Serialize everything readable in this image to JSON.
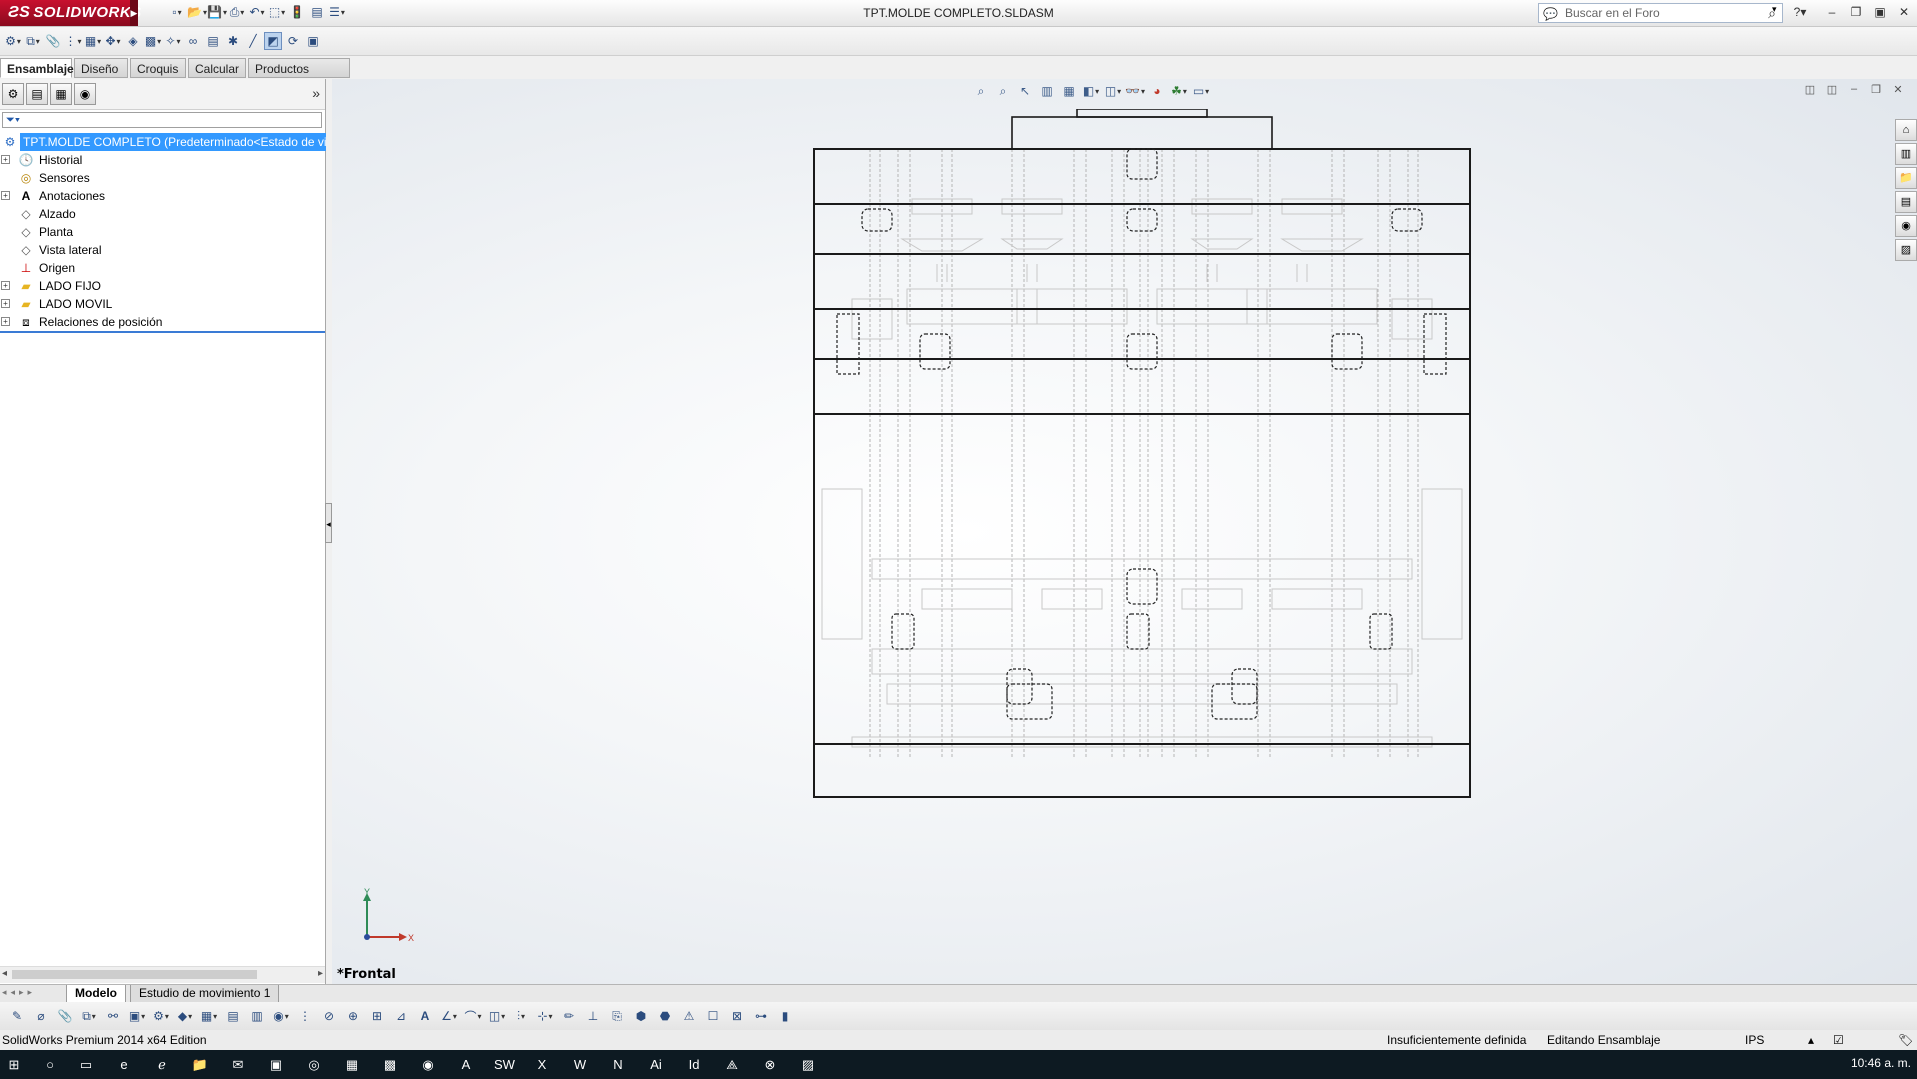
{
  "app": {
    "logo": "SOLIDWORKS",
    "window_title": "TPT.MOLDE COMPLETO.SLDASM",
    "search_placeholder": "Buscar en el Foro"
  },
  "tabs": [
    "Ensamblaje",
    "Diseño",
    "Croquis",
    "Calcular",
    "Productos Office"
  ],
  "tree": {
    "root": "TPT.MOLDE COMPLETO  (Predeterminado<Estado de visu",
    "items": [
      {
        "label": "Historial",
        "icon": "history-icon",
        "expand": true
      },
      {
        "label": "Sensores",
        "icon": "sensor-icon",
        "expand": false
      },
      {
        "label": "Anotaciones",
        "icon": "annotation-icon",
        "expand": true
      },
      {
        "label": "Alzado",
        "icon": "plane-icon",
        "expand": false
      },
      {
        "label": "Planta",
        "icon": "plane-icon",
        "expand": false
      },
      {
        "label": "Vista lateral",
        "icon": "plane-icon",
        "expand": false
      },
      {
        "label": "Origen",
        "icon": "origin-icon",
        "expand": false
      },
      {
        "label": "LADO FIJO",
        "icon": "folder-icon",
        "expand": true
      },
      {
        "label": "LADO MOVIL",
        "icon": "folder-icon",
        "expand": true
      },
      {
        "label": "Relaciones de posición",
        "icon": "mates-icon",
        "expand": true
      }
    ]
  },
  "viewport": {
    "view_label": "*Frontal",
    "triad_x": "X",
    "triad_y": "Y"
  },
  "bottom_tabs": [
    "Modelo",
    "Estudio de movimiento 1"
  ],
  "status": {
    "edition": "SolidWorks Premium 2014 x64 Edition",
    "definition": "Insuficientemente definida",
    "mode": "Editando Ensamblaje",
    "units": "IPS"
  },
  "taskbar": {
    "clock": "10:46 a. m."
  },
  "colors": {
    "brand": "#c8102e",
    "selection": "#3399ff",
    "taskbar": "#0d1a22"
  }
}
